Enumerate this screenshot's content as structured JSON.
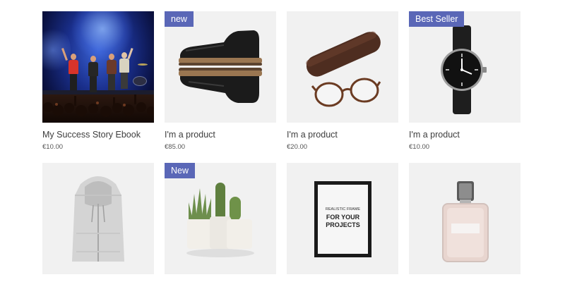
{
  "products": [
    {
      "name": "My Success Story Ebook",
      "price": "€10.00",
      "ribbon": ""
    },
    {
      "name": "I'm a product",
      "price": "€85.00",
      "ribbon": "new"
    },
    {
      "name": "I'm a product",
      "price": "€20.00",
      "ribbon": ""
    },
    {
      "name": "I'm a product",
      "price": "€10.00",
      "ribbon": "Best Seller"
    },
    {
      "ribbon": ""
    },
    {
      "ribbon": "New"
    },
    {
      "ribbon": ""
    },
    {
      "ribbon": ""
    }
  ],
  "frame_art": {
    "small_text": "REALISTIC FRAME",
    "line1": "FOR YOUR",
    "line2": "PROJECTS"
  },
  "colors": {
    "ribbon": "#5a67b7",
    "tile_background": "#f1f1f1",
    "product_name": "#3d3d3d"
  }
}
